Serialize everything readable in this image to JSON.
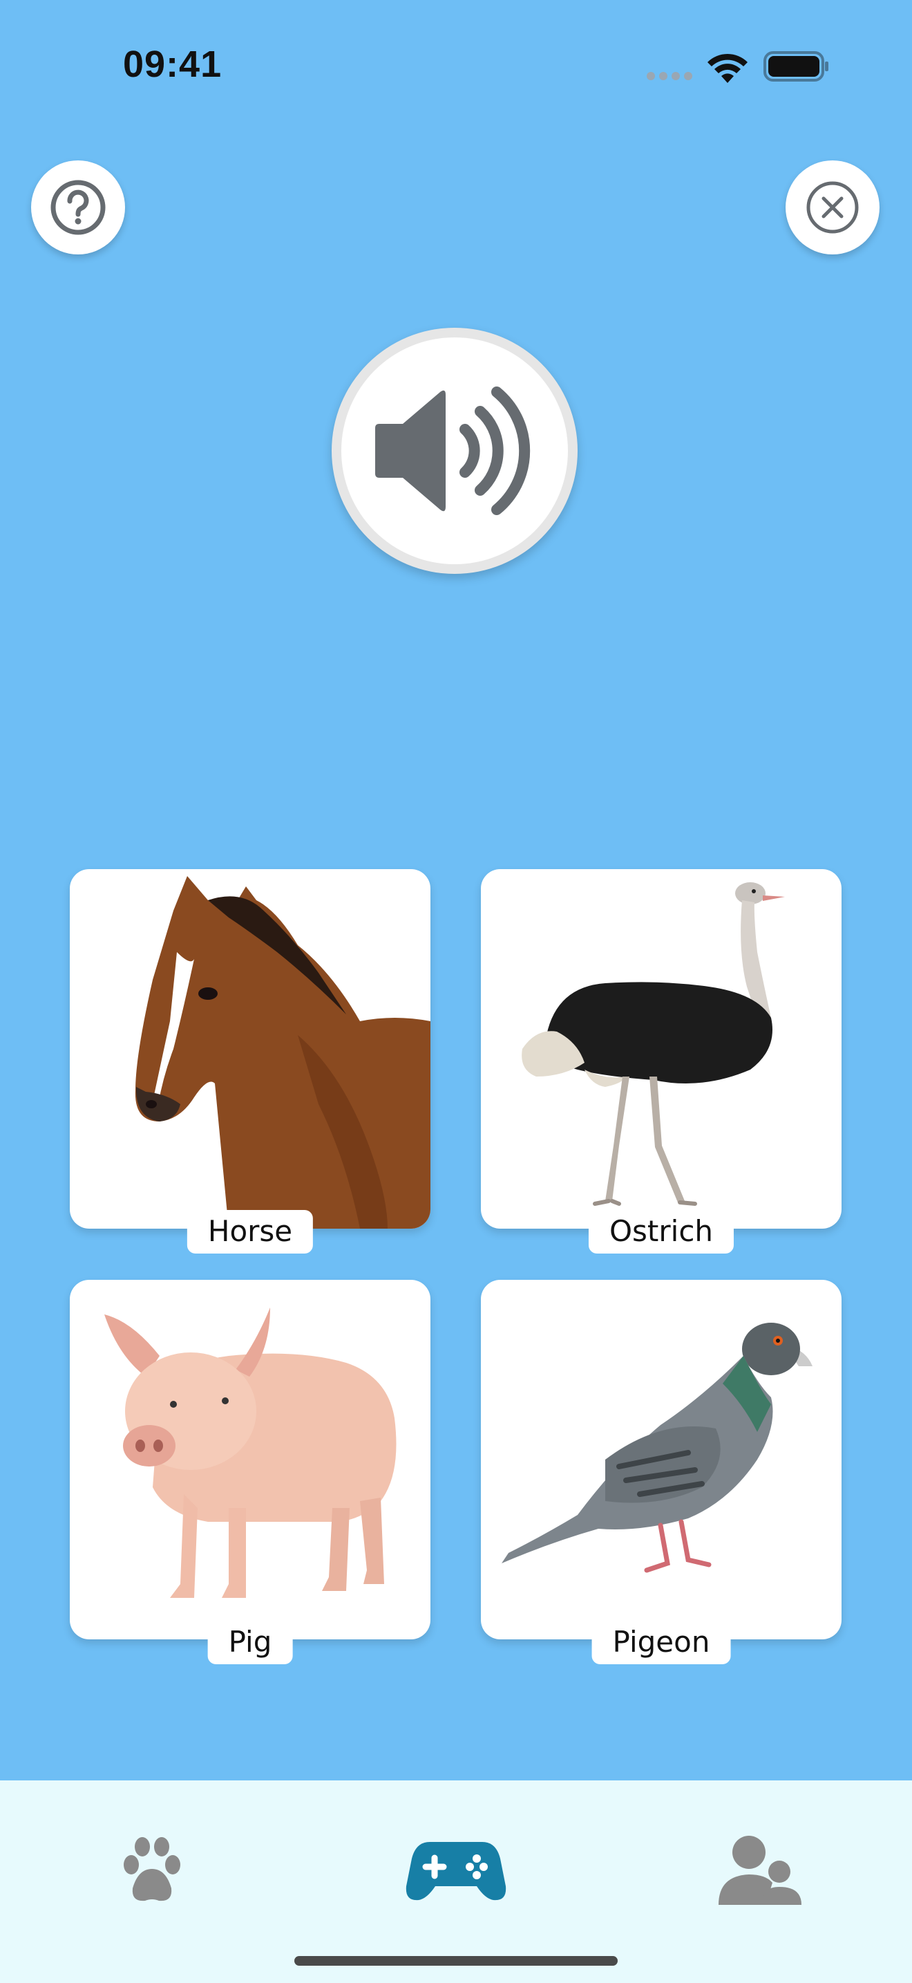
{
  "status_bar": {
    "time": "09:41"
  },
  "header": {
    "help_icon": "question-circle-icon",
    "close_icon": "close-circle-icon"
  },
  "sound_button": {
    "icon": "speaker-icon"
  },
  "cards": [
    {
      "label": "Horse",
      "image": "horse"
    },
    {
      "label": "Ostrich",
      "image": "ostrich"
    },
    {
      "label": "Pig",
      "image": "pig"
    },
    {
      "label": "Pigeon",
      "image": "pigeon"
    }
  ],
  "tabs": [
    {
      "icon": "paw-icon",
      "color": "#8a8a8a"
    },
    {
      "icon": "gamepad-icon",
      "color": "#177fa6",
      "selected": true
    },
    {
      "icon": "profile-icon",
      "color": "#8a8a8a"
    }
  ],
  "colors": {
    "background": "#6ebef5",
    "tab_bar": "#e7fafd",
    "active_tab": "#177fa6"
  }
}
